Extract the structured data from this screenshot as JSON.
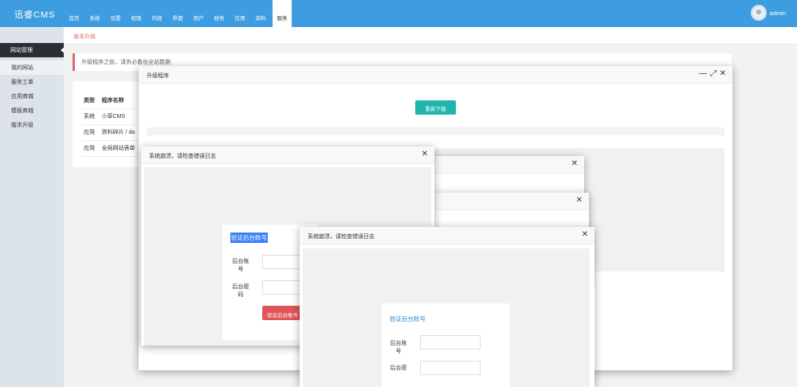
{
  "app": {
    "logo": "迅睿CMS"
  },
  "nav": [
    {
      "icon": "",
      "label": "首页"
    },
    {
      "icon": "",
      "label": "系统"
    },
    {
      "icon": "",
      "label": "设置"
    },
    {
      "icon": "",
      "label": "权限"
    },
    {
      "icon": "",
      "label": "内容"
    },
    {
      "icon": "",
      "label": "界面"
    },
    {
      "icon": "",
      "label": "用户"
    },
    {
      "icon": "",
      "label": "财务"
    },
    {
      "icon": "",
      "label": "应用"
    },
    {
      "icon": "",
      "label": "资料"
    },
    {
      "icon": "",
      "label": "服务"
    }
  ],
  "user": {
    "name": "admin",
    "caret": ""
  },
  "sidebar": {
    "heading": "网站管理",
    "heading_icon": "",
    "heading_icon2": "",
    "items": [
      {
        "icon": "",
        "label": "我的网站"
      },
      {
        "icon": "",
        "label": "服务工单"
      },
      {
        "icon": "",
        "label": "应用商城"
      },
      {
        "icon": "",
        "label": "模板商城"
      },
      {
        "icon": "",
        "label": "版本升级"
      }
    ]
  },
  "breadcrumb": {
    "text": " 版本升级 "
  },
  "notice": {
    "text": "升级程序之前，请务必备份全站数据"
  },
  "table": {
    "headers": [
      "类型",
      "程序名称"
    ],
    "rows": [
      [
        "系统",
        "小草CMS"
      ],
      [
        "应用",
        "资料碎片 / da"
      ],
      [
        "应用",
        "全局网站表单"
      ]
    ]
  },
  "upgrade_window": {
    "title": "升级程序",
    "min_icon": "—",
    "max_icon": "⤢",
    "close_icon": "✕",
    "redownload": " 重新下载"
  },
  "error_window_1": {
    "title": "系统崩溃，请检查错误日志",
    "close_icon": "✕",
    "form_title": "验证后台账号",
    "label_account": "后台账号",
    "label_password": "后台密码",
    "button": "验证后台账号"
  },
  "error_window_2": {
    "close_icon": "✕"
  },
  "error_window_3": {
    "close_icon": "✕"
  },
  "error_window_4": {
    "title": "系统崩溃，请检查错误日志",
    "close_icon": "✕",
    "form_title": "验证后台账号",
    "label_account": "后台账号",
    "label_password": "后台密"
  },
  "colors": {
    "header": "#3e9de0",
    "accent_teal": "#1fb5ad",
    "danger": "#e0545a"
  }
}
